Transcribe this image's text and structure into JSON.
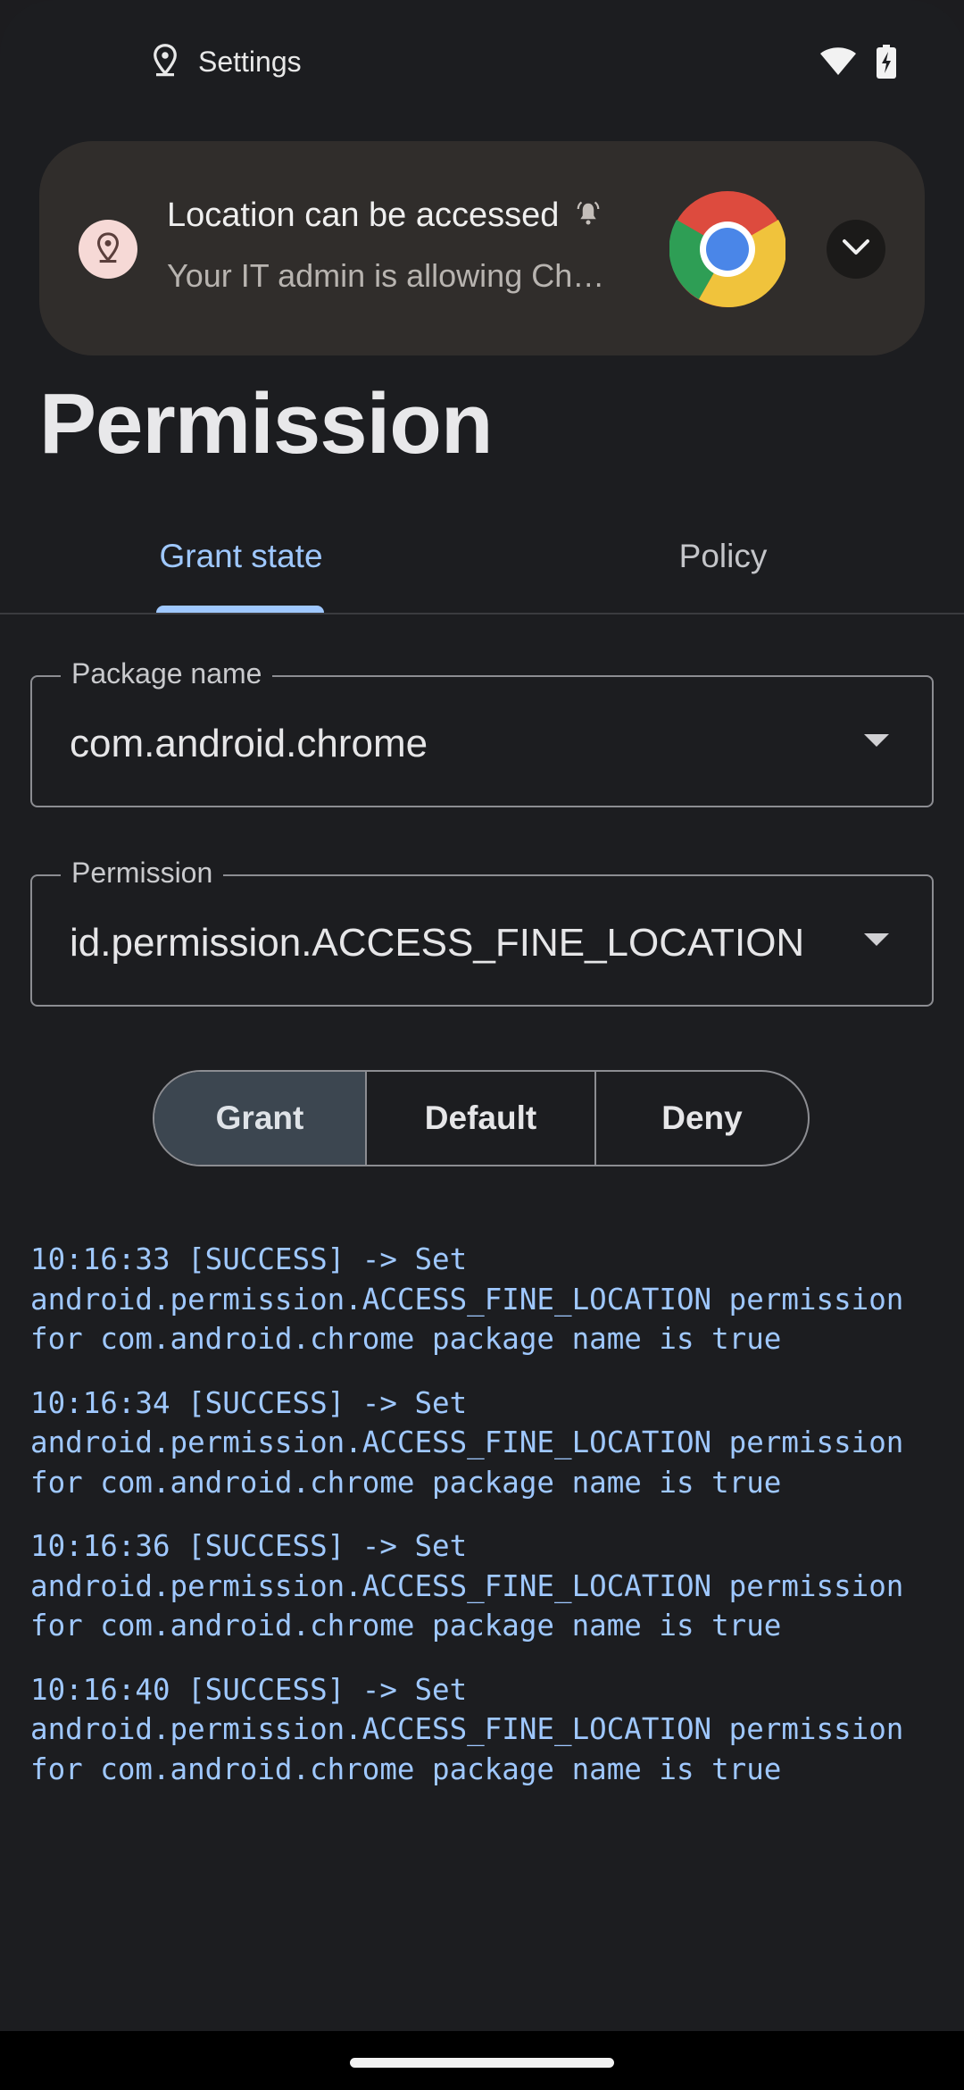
{
  "status_bar": {
    "title": "Settings"
  },
  "notification": {
    "title": "Location can be accessed",
    "text": "Your IT admin is allowing Ch…",
    "app": "Chrome"
  },
  "page": {
    "title": "Permission"
  },
  "tabs": [
    {
      "label": "Grant state",
      "selected": true
    },
    {
      "label": "Policy",
      "selected": false
    }
  ],
  "fields": {
    "package": {
      "label": "Package name",
      "value": "com.android.chrome"
    },
    "permission": {
      "label": "Permission",
      "value": "id.permission.ACCESS_FINE_LOCATION"
    }
  },
  "segmented": {
    "options": [
      "Grant",
      "Default",
      "Deny"
    ],
    "selected": "Grant"
  },
  "log": [
    "10:16:33 [SUCCESS] -> Set\nandroid.permission.ACCESS_FINE_LOCATION permission\nfor com.android.chrome package name is true",
    "10:16:34 [SUCCESS] -> Set\nandroid.permission.ACCESS_FINE_LOCATION permission\nfor com.android.chrome package name is true",
    "10:16:36 [SUCCESS] -> Set\nandroid.permission.ACCESS_FINE_LOCATION permission\nfor com.android.chrome package name is true",
    "10:16:40 [SUCCESS] -> Set\nandroid.permission.ACCESS_FINE_LOCATION permission\nfor com.android.chrome package name is true"
  ],
  "colors": {
    "accent": "#9fc8ff",
    "background": "#1c1d20",
    "notification_bg": "#302d2b",
    "selected_segment": "#3c4650"
  },
  "icons": [
    "location-pin-icon",
    "wifi-icon",
    "battery-charging-icon",
    "location-pin-icon",
    "bell-icon",
    "chrome-icon",
    "chevron-down-icon",
    "dropdown-arrow-icon"
  ]
}
